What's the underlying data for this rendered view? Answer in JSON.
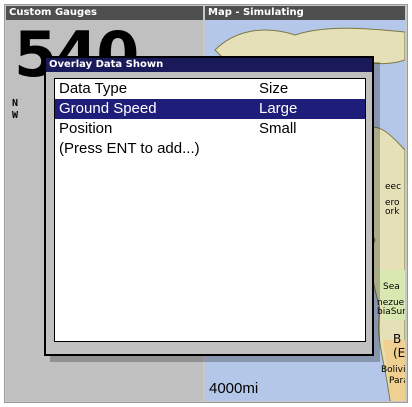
{
  "left_pane": {
    "title": "Custom Gauges",
    "big_value": "540",
    "small_labels": [
      "N",
      "W"
    ]
  },
  "right_pane": {
    "title": "Map - Simulating",
    "scale": "4000mi",
    "labels": [
      "eec",
      "ero",
      "ork",
      "Sea",
      "nezue",
      "biaSur",
      "B",
      "(E",
      "Bolivia",
      "Para"
    ]
  },
  "dialog": {
    "title": "Overlay Data Shown",
    "header": {
      "col1": "Data Type",
      "col2": "Size"
    },
    "rows": [
      {
        "col1": "Ground Speed",
        "col2": "Large"
      },
      {
        "col1": "Position",
        "col2": "Small"
      },
      {
        "col1": "(Press ENT to add...)",
        "col2": ""
      }
    ]
  },
  "colors": {
    "selection": "#1e1e7a",
    "title_bar": "#1a1a5a",
    "pane_title": "#4f4f4f"
  }
}
